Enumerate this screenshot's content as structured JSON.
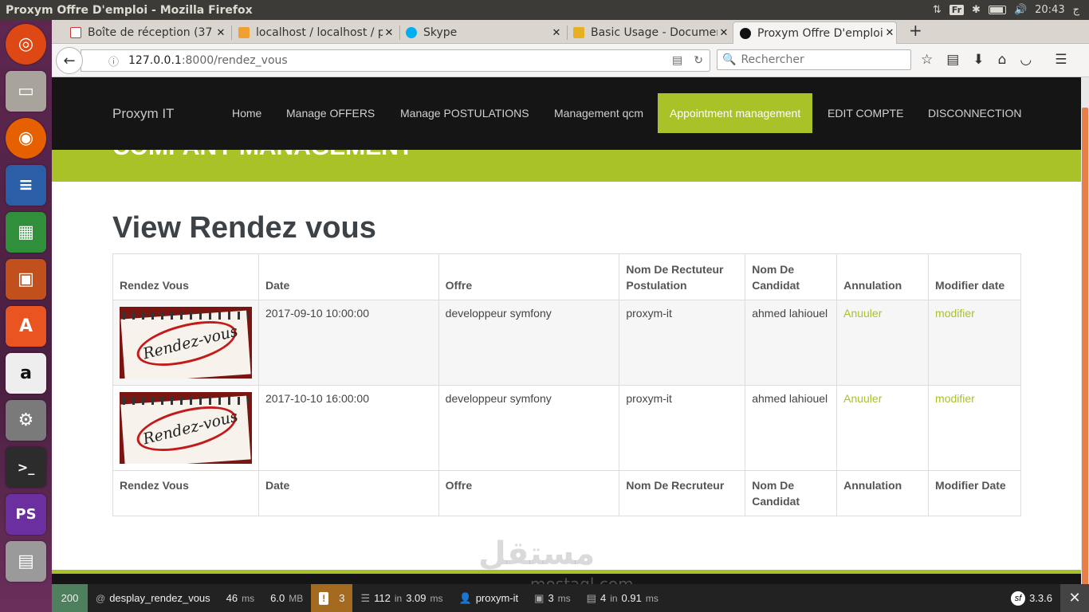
{
  "window": {
    "title": "Proxym Offre D'emploi - Mozilla Firefox",
    "kbd": "Fr",
    "clock": "20:43",
    "locale_glyph": "ج"
  },
  "tabs": [
    {
      "label": "Boîte de réception (37",
      "icon": "gmail-icon"
    },
    {
      "label": "localhost / localhost / p",
      "icon": "phpmyadmin-icon"
    },
    {
      "label": "Skype",
      "icon": "skype-icon"
    },
    {
      "label": "Basic Usage - Documen",
      "icon": "docs-icon"
    },
    {
      "label": "Proxym Offre D'emploi",
      "icon": "symfony-icon"
    }
  ],
  "url": {
    "host": "127.0.0.1",
    "rest": ":8000/rendez_vous"
  },
  "search": {
    "placeholder": "Rechercher"
  },
  "site": {
    "brand": "Proxym IT",
    "menu": [
      "Home",
      "Manage OFFERS",
      "Manage POSTULATIONS",
      "Management qcm",
      "Appointment management",
      "EDIT COMPTE",
      "DISCONNECTION"
    ],
    "active_menu": "Appointment management",
    "band_title": "COMPANY MANAGEMENT",
    "heading": "View Rendez vous"
  },
  "table": {
    "headers": [
      "Rendez Vous",
      "Date",
      "Offre",
      "Nom De Rectuteur Postulation",
      "Nom De Candidat",
      "Annulation",
      "Modifier date"
    ],
    "rows": [
      {
        "image_text": "Rendez-vous",
        "date": "2017-09-10 10:00:00",
        "offre": "developpeur symfony",
        "recruteur": "proxym-it",
        "candidat": "ahmed lahiouel",
        "annuler": "Anuuler",
        "modifier": "modifier"
      },
      {
        "image_text": "Rendez-vous",
        "date": "2017-10-10 16:00:00",
        "offre": "developpeur symfony",
        "recruteur": "proxym-it",
        "candidat": "ahmed lahiouel",
        "annuler": "Anuuler",
        "modifier": "modifier"
      }
    ],
    "footers": [
      "Rendez Vous",
      "Date",
      "Offre",
      "Nom De Recruteur",
      "Nom De Candidat",
      "Annulation",
      "Modifier Date"
    ]
  },
  "watermark": {
    "arabic": "مستقل",
    "latin": "mostaql.com"
  },
  "profiler": {
    "status": "200",
    "route": "desplay_rendez_vous",
    "time": "46",
    "time_unit": "ms",
    "memory": "6.0",
    "memory_unit": "MB",
    "errors": "3",
    "queries": "112",
    "queries_in": "in",
    "queries_time": "3.09",
    "queries_unit": "ms",
    "user": "proxym-it",
    "forms": "3",
    "forms_unit": "ms",
    "cache": "4",
    "cache_in": "in",
    "cache_time": "0.91",
    "cache_unit": "ms",
    "version": "3.3.6"
  },
  "colors": {
    "accent": "#a8c227",
    "nav_bg": "#151515",
    "launcher": "#5e2750"
  }
}
